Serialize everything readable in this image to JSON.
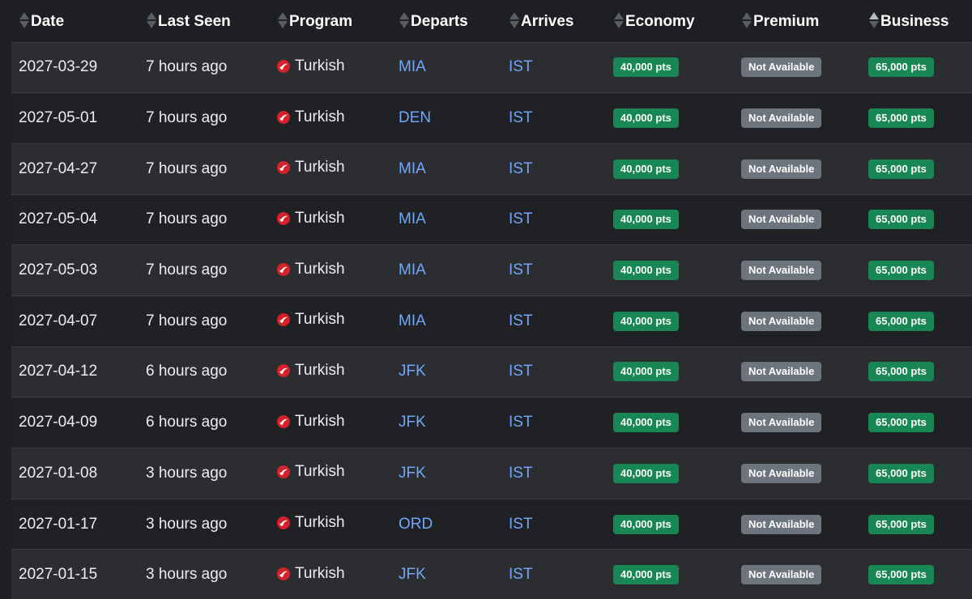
{
  "columns": [
    {
      "label": "Date",
      "sort": "none"
    },
    {
      "label": "Last Seen",
      "sort": "none"
    },
    {
      "label": "Program",
      "sort": "none"
    },
    {
      "label": "Departs",
      "sort": "none"
    },
    {
      "label": "Arrives",
      "sort": "none"
    },
    {
      "label": "Economy",
      "sort": "none"
    },
    {
      "label": "Premium",
      "sort": "none"
    },
    {
      "label": "Business",
      "sort": "asc"
    }
  ],
  "rows": [
    {
      "date": "2027-03-29",
      "last_seen": "7 hours ago",
      "program": "Turkish",
      "program_icon": "turkish-airlines-icon",
      "departs": "MIA",
      "arrives": "IST",
      "economy": "40,000 pts",
      "premium": "Not Available",
      "business": "65,000 pts"
    },
    {
      "date": "2027-05-01",
      "last_seen": "7 hours ago",
      "program": "Turkish",
      "program_icon": "turkish-airlines-icon",
      "departs": "DEN",
      "arrives": "IST",
      "economy": "40,000 pts",
      "premium": "Not Available",
      "business": "65,000 pts"
    },
    {
      "date": "2027-04-27",
      "last_seen": "7 hours ago",
      "program": "Turkish",
      "program_icon": "turkish-airlines-icon",
      "departs": "MIA",
      "arrives": "IST",
      "economy": "40,000 pts",
      "premium": "Not Available",
      "business": "65,000 pts"
    },
    {
      "date": "2027-05-04",
      "last_seen": "7 hours ago",
      "program": "Turkish",
      "program_icon": "turkish-airlines-icon",
      "departs": "MIA",
      "arrives": "IST",
      "economy": "40,000 pts",
      "premium": "Not Available",
      "business": "65,000 pts"
    },
    {
      "date": "2027-05-03",
      "last_seen": "7 hours ago",
      "program": "Turkish",
      "program_icon": "turkish-airlines-icon",
      "departs": "MIA",
      "arrives": "IST",
      "economy": "40,000 pts",
      "premium": "Not Available",
      "business": "65,000 pts"
    },
    {
      "date": "2027-04-07",
      "last_seen": "7 hours ago",
      "program": "Turkish",
      "program_icon": "turkish-airlines-icon",
      "departs": "MIA",
      "arrives": "IST",
      "economy": "40,000 pts",
      "premium": "Not Available",
      "business": "65,000 pts"
    },
    {
      "date": "2027-04-12",
      "last_seen": "6 hours ago",
      "program": "Turkish",
      "program_icon": "turkish-airlines-icon",
      "departs": "JFK",
      "arrives": "IST",
      "economy": "40,000 pts",
      "premium": "Not Available",
      "business": "65,000 pts"
    },
    {
      "date": "2027-04-09",
      "last_seen": "6 hours ago",
      "program": "Turkish",
      "program_icon": "turkish-airlines-icon",
      "departs": "JFK",
      "arrives": "IST",
      "economy": "40,000 pts",
      "premium": "Not Available",
      "business": "65,000 pts"
    },
    {
      "date": "2027-01-08",
      "last_seen": "3 hours ago",
      "program": "Turkish",
      "program_icon": "turkish-airlines-icon",
      "departs": "JFK",
      "arrives": "IST",
      "economy": "40,000 pts",
      "premium": "Not Available",
      "business": "65,000 pts"
    },
    {
      "date": "2027-01-17",
      "last_seen": "3 hours ago",
      "program": "Turkish",
      "program_icon": "turkish-airlines-icon",
      "departs": "ORD",
      "arrives": "IST",
      "economy": "40,000 pts",
      "premium": "Not Available",
      "business": "65,000 pts"
    },
    {
      "date": "2027-01-15",
      "last_seen": "3 hours ago",
      "program": "Turkish",
      "program_icon": "turkish-airlines-icon",
      "departs": "JFK",
      "arrives": "IST",
      "economy": "40,000 pts",
      "premium": "Not Available",
      "business": "65,000 pts"
    }
  ],
  "colors": {
    "background": "#1d1f22",
    "row_odd": "#2b2d30",
    "row_even": "#1f2124",
    "link": "#6ea8fe",
    "available_badge": "#198754",
    "unavailable_badge": "#6c757d",
    "airline_logo": "#d9202a"
  }
}
